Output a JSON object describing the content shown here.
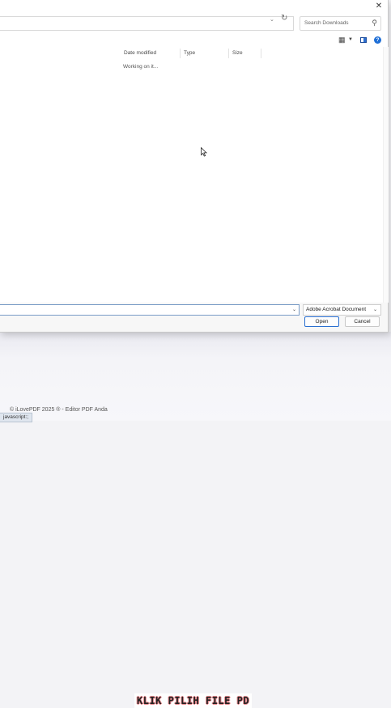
{
  "dialog": {
    "search": {
      "placeholder": "Search Downloads"
    },
    "columns": [
      "Date modified",
      "Type",
      "Size"
    ],
    "status": "Working on it...",
    "file_type": "Adobe Acrobat Document",
    "open_label": "Open",
    "cancel_label": "Cancel"
  },
  "background": {
    "caption": "KLIK PILIH FILE PD",
    "footer": "© iLovePDF 2025 ® - Editor PDF Anda",
    "status_chip": "javascript:;"
  },
  "icons": {
    "close": "close-icon",
    "refresh": "refresh-icon",
    "search": "search-icon",
    "view": "view-options-icon",
    "preview_pane": "preview-pane-icon",
    "help": "help-icon"
  },
  "colors": {
    "accent": "#2a6fd0",
    "help": "#1f6fd6"
  }
}
